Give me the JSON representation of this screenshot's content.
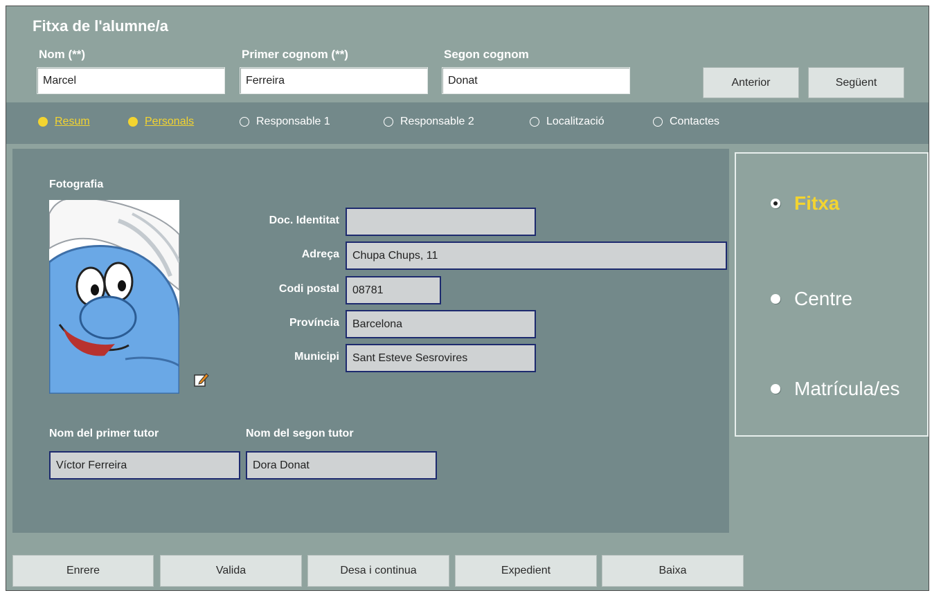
{
  "header": {
    "title": "Fitxa de l'alumne/a",
    "nom_label": "Nom (**)",
    "nom_value": "Marcel",
    "cognom1_label": "Primer cognom (**)",
    "cognom1_value": "Ferreira",
    "cognom2_label": "Segon cognom",
    "cognom2_value": "Donat",
    "prev_label": "Anterior",
    "next_label": "Següent"
  },
  "tabs": [
    {
      "label": "Resum",
      "active": true
    },
    {
      "label": "Personals",
      "active": true
    },
    {
      "label": "Responsable 1",
      "active": false
    },
    {
      "label": "Responsable 2",
      "active": false
    },
    {
      "label": "Localització",
      "active": false
    },
    {
      "label": "Contactes",
      "active": false
    }
  ],
  "personal": {
    "photo_label": "Fotografia",
    "photo_icon": "smurf-avatar",
    "edit_icon": "edit-pencil-icon",
    "fields": [
      {
        "label": "Doc. Identitat",
        "value": ""
      },
      {
        "label": "Adreça",
        "value": "Chupa Chups, 11"
      },
      {
        "label": "Codi postal",
        "value": "08781"
      },
      {
        "label": "Província",
        "value": "Barcelona"
      },
      {
        "label": "Municipi",
        "value": "Sant Esteve Sesrovires"
      }
    ],
    "tutor1_label": "Nom del primer tutor",
    "tutor1_value": "Víctor Ferreira",
    "tutor2_label": "Nom del segon tutor",
    "tutor2_value": "Dora Donat"
  },
  "side_options": [
    {
      "label": "Fitxa",
      "selected": true
    },
    {
      "label": "Centre",
      "selected": false
    },
    {
      "label": "Matrícula/es",
      "selected": false
    }
  ],
  "bottom_buttons": [
    "Enrere",
    "Valida",
    "Desa i continua",
    "Expedient",
    "Baixa"
  ],
  "colors": {
    "background": "#8fa39e",
    "panel": "#73898a",
    "accent": "#f3d430",
    "field_border": "#1d2a6e",
    "field_bg": "#cfd2d3"
  }
}
